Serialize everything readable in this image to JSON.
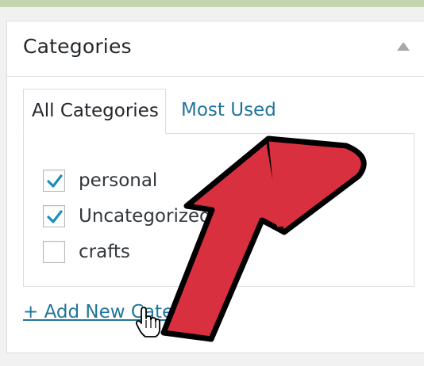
{
  "panel": {
    "title": "Categories"
  },
  "tabs": [
    {
      "label": "All Categories",
      "active": true
    },
    {
      "label": "Most Used",
      "active": false
    }
  ],
  "categories": [
    {
      "label": "personal",
      "checked": true
    },
    {
      "label": "Uncategorized",
      "checked": true
    },
    {
      "label": "crafts",
      "checked": false
    }
  ],
  "add_link": {
    "label": "+ Add New Category"
  },
  "colors": {
    "accent_link": "#21759b",
    "check_mark": "#1e8cbe",
    "arrow_fill": "#d93040",
    "top_strip": "#c4d3b0"
  },
  "icons": [
    "collapse-arrow-icon",
    "checkmark-icon",
    "red-pointer-arrow-icon",
    "hand-cursor-icon"
  ]
}
